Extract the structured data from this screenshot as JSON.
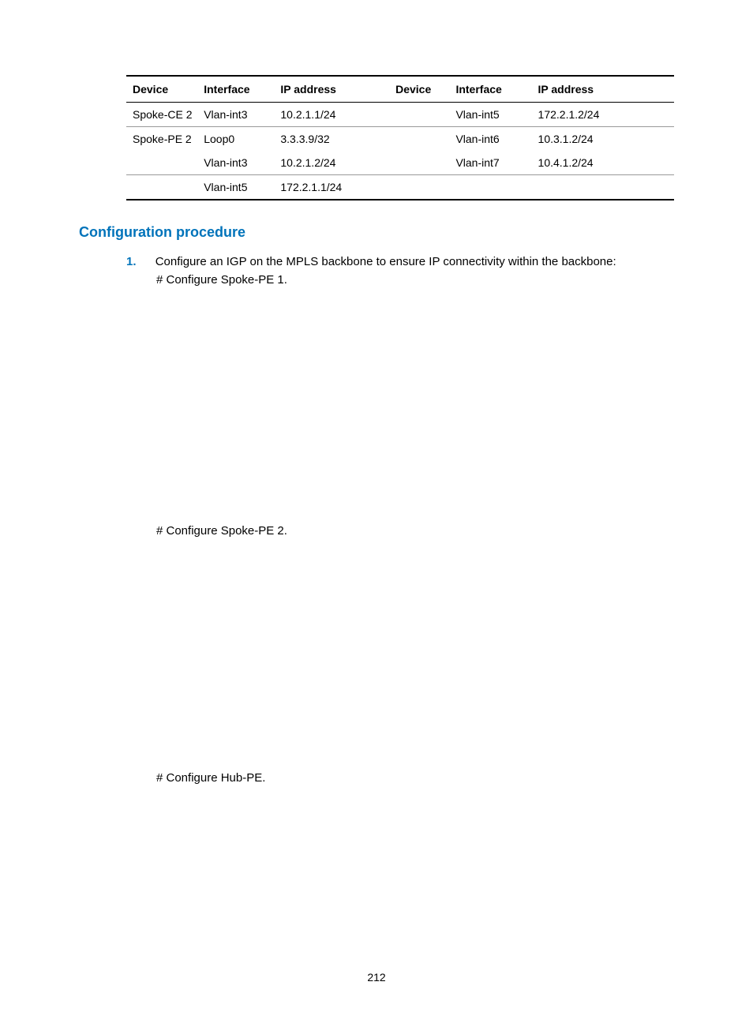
{
  "table": {
    "headers": [
      "Device",
      "Interface",
      "IP address",
      "Device",
      "Interface",
      "IP address"
    ],
    "rows": [
      [
        "Spoke-CE 2",
        "Vlan-int3",
        "10.2.1.1/24",
        "",
        "Vlan-int5",
        "172.2.1.2/24"
      ],
      [
        "Spoke-PE 2",
        "Loop0",
        "3.3.3.9/32",
        "",
        "Vlan-int6",
        "10.3.1.2/24"
      ],
      [
        "",
        "Vlan-int3",
        "10.2.1.2/24",
        "",
        "Vlan-int7",
        "10.4.1.2/24"
      ],
      [
        "",
        "Vlan-int5",
        "172.2.1.1/24",
        "",
        "",
        ""
      ]
    ]
  },
  "section_heading": "Configuration procedure",
  "list": {
    "number": "1.",
    "line1": "Configure an IGP on the MPLS backbone to ensure IP connectivity within the backbone:",
    "line2": "# Configure Spoke-PE 1.",
    "line3": "# Configure Spoke-PE 2.",
    "line4": "# Configure Hub-PE."
  },
  "page_number": "212"
}
